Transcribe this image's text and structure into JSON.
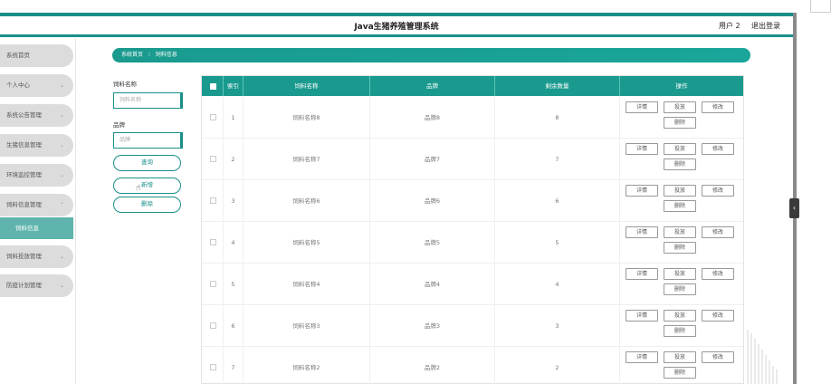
{
  "header": {
    "title": "Java生猪养殖管理系统",
    "user": "用户 2",
    "logout": "退出登录"
  },
  "sidebar": {
    "items": [
      {
        "label": "系统首页",
        "chevron": ""
      },
      {
        "label": "个人中心",
        "chevron": "⌄"
      },
      {
        "label": "系统公告管理",
        "chevron": "⌄"
      },
      {
        "label": "生猪信息管理",
        "chevron": "⌄"
      },
      {
        "label": "环境监控管理",
        "chevron": "⌄"
      },
      {
        "label": "饲料信息管理",
        "chevron": "⌃"
      },
      {
        "label": "饲料投放管理",
        "chevron": "⌄"
      },
      {
        "label": "防疫计划管理",
        "chevron": "⌄"
      }
    ],
    "sub_item": "饲料信息"
  },
  "breadcrumb": {
    "home": "系统首页",
    "separator": "⁝",
    "current": "饲料信息"
  },
  "search": {
    "name_label": "饲料名称",
    "name_placeholder": "饲料名称",
    "brand_label": "品牌",
    "brand_placeholder": "品牌",
    "query_button": "查询",
    "add_button": "新增",
    "delete_button": "删除"
  },
  "table": {
    "columns": [
      "索引",
      "饲料名称",
      "品牌",
      "剩余数量",
      "操作"
    ],
    "rows": [
      {
        "index": "1",
        "name": "饲料名称8",
        "brand": "品牌8",
        "remaining": "8"
      },
      {
        "index": "2",
        "name": "饲料名称7",
        "brand": "品牌7",
        "remaining": "7"
      },
      {
        "index": "3",
        "name": "饲料名称6",
        "brand": "品牌6",
        "remaining": "6"
      },
      {
        "index": "4",
        "name": "饲料名称5",
        "brand": "品牌5",
        "remaining": "5"
      },
      {
        "index": "5",
        "name": "饲料名称4",
        "brand": "品牌4",
        "remaining": "4"
      },
      {
        "index": "6",
        "name": "饲料名称3",
        "brand": "品牌3",
        "remaining": "3"
      },
      {
        "index": "7",
        "name": "饲料名称2",
        "brand": "品牌2",
        "remaining": "2"
      }
    ],
    "actions": {
      "detail": "详情",
      "feed": "投放",
      "edit": "修改",
      "delete": "删除"
    }
  },
  "colors": {
    "accent": "#1a9a8e",
    "sidebar_bg": "#dcdcdc",
    "sidebar_active": "#5fb5ad"
  },
  "icons": {
    "sidebar_handle": "chevron-left-icon",
    "pointer": "hand-pointer-icon"
  }
}
